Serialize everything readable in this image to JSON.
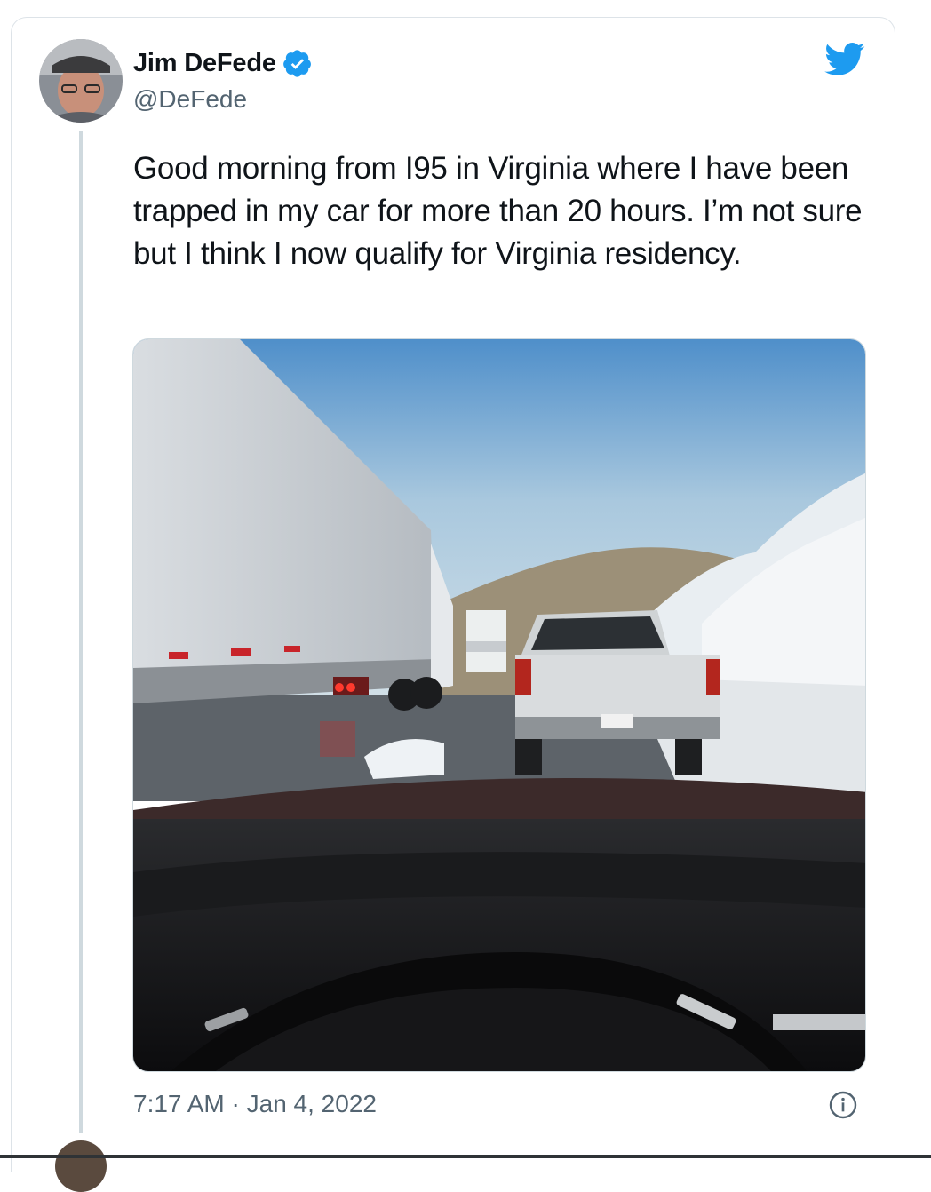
{
  "tweet": {
    "author_name": "Jim DeFede",
    "author_handle": "@DeFede",
    "text": "Good morning from I95 in Virginia where I have been trapped in my car for more than 20 hours. I’m not sure but I think I now qualify for Virginia residency.",
    "time": "7:17 AM",
    "separator": " · ",
    "date": "Jan 4, 2022"
  },
  "icons": {
    "verified": "verified-badge-icon",
    "brand": "twitter-bird-icon",
    "info": "info-icon"
  },
  "colors": {
    "brand_blue": "#1d9bf0",
    "text_primary": "#0f1419",
    "text_secondary": "#536471",
    "border": "#cfd9de"
  }
}
